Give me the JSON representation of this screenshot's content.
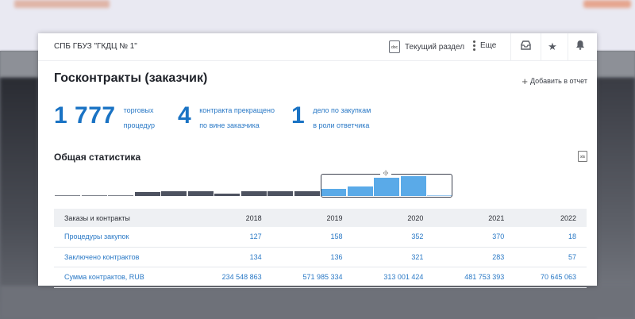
{
  "header": {
    "org_name": "СПБ ГБУЗ \"ГКДЦ № 1\"",
    "current_section": "Текущий раздел",
    "more": "Еще",
    "doc_icon_text": "doc"
  },
  "page": {
    "title": "Госконтракты (заказчик)",
    "add_to_report": "Добавить в отчет"
  },
  "kpis": [
    {
      "value": "1 777",
      "line1": "торговых",
      "line2": "процедур"
    },
    {
      "value": "4",
      "line1": "контракта прекращено",
      "line2": "по вине заказчика"
    },
    {
      "value": "1",
      "line1": "дело по закупкам",
      "line2": "в роли ответчика"
    }
  ],
  "stats": {
    "title": "Общая статистика",
    "xls_icon_text": "xls"
  },
  "timeline": {
    "bars": [
      {
        "level": 0.05,
        "selected": false
      },
      {
        "level": 0.05,
        "selected": false
      },
      {
        "level": 0.05,
        "selected": false
      },
      {
        "level": 0.2,
        "selected": false
      },
      {
        "level": 0.25,
        "selected": false
      },
      {
        "level": 0.25,
        "selected": false
      },
      {
        "level": 0.1,
        "selected": false
      },
      {
        "level": 0.25,
        "selected": false
      },
      {
        "level": 0.25,
        "selected": false
      },
      {
        "level": 0.25,
        "selected": false
      },
      {
        "level": 0.36,
        "selected": true
      },
      {
        "level": 0.45,
        "selected": true
      },
      {
        "level": 0.9,
        "selected": true
      },
      {
        "level": 0.95,
        "selected": true
      },
      {
        "level": 0.05,
        "selected": true
      }
    ],
    "colors": {
      "normal": "#4d5260",
      "selected": "#5aaae8",
      "empty": "#7f838c"
    }
  },
  "table": {
    "headers": [
      "Заказы и контракты",
      "2018",
      "2019",
      "2020",
      "2021",
      "2022"
    ],
    "rows": [
      [
        "Процедуры закупок",
        "127",
        "158",
        "352",
        "370",
        "18"
      ],
      [
        "Заключено контрактов",
        "134",
        "136",
        "321",
        "283",
        "57"
      ],
      [
        "Сумма контрактов, RUB",
        "234 548 863",
        "571 985 334",
        "313 001 424",
        "481 753 393",
        "70 645 063"
      ]
    ]
  },
  "colors": {
    "accent": "#1a73c4",
    "link": "#2a79c6"
  }
}
